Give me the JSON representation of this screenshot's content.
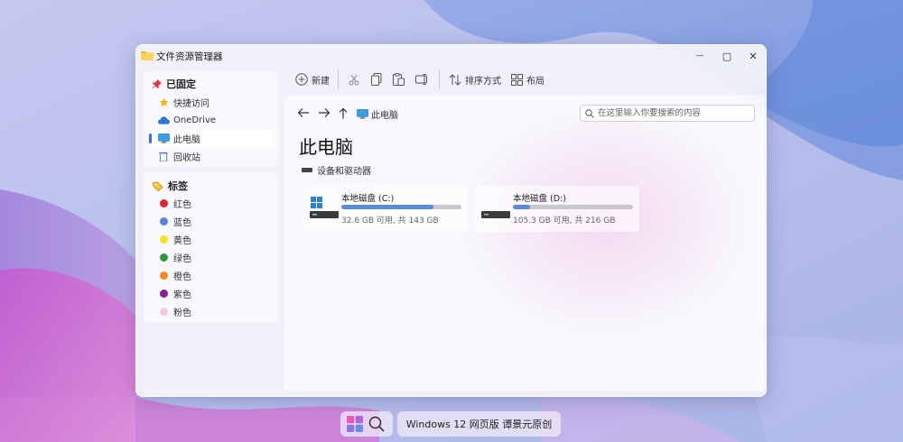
{
  "window": {
    "title": "文件资源管理器",
    "controls": {
      "minimize": "—",
      "maximize": "▢",
      "close": "✕"
    }
  },
  "sidebar": {
    "pinned_header": "已固定",
    "pinned_items": [
      {
        "label": "快捷访问",
        "icon": "star-icon"
      },
      {
        "label": "OneDrive",
        "icon": "cloud-icon"
      },
      {
        "label": "此电脑",
        "icon": "monitor-icon",
        "active": true
      },
      {
        "label": "回收站",
        "icon": "recycle-bin-icon"
      }
    ],
    "tags_header": "标签",
    "tags": [
      {
        "label": "红色",
        "color": "#e5212a"
      },
      {
        "label": "蓝色",
        "color": "#5b7fd9"
      },
      {
        "label": "黄色",
        "color": "#f4e40f"
      },
      {
        "label": "绿色",
        "color": "#2a9a36"
      },
      {
        "label": "橙色",
        "color": "#f08a1c"
      },
      {
        "label": "紫色",
        "color": "#8a1d8f"
      },
      {
        "label": "粉色",
        "color": "#f5c9dc"
      }
    ]
  },
  "toolbar": {
    "new_label": "新建",
    "sort_label": "排序方式",
    "layout_label": "布局"
  },
  "navigation": {
    "breadcrumb": "此电脑",
    "search_placeholder": "在这里输入你要搜索的内容"
  },
  "main": {
    "page_title": "此电脑",
    "section_title": "设备和驱动器",
    "drives": [
      {
        "name": "本地磁盘 (C:)",
        "info": "32.6 GB 可用, 共 143 GB",
        "used_fraction": 0.77
      },
      {
        "name": "本地磁盘 (D:)",
        "info": "105.3 GB 可用, 共 216 GB",
        "used_fraction": 0.14
      }
    ]
  },
  "taskbar": {
    "label": "Windows 12 网页版 谭景元原创"
  },
  "colors": {
    "accent": "#3a6ee0",
    "drive_fill": "#5b8bd6"
  }
}
